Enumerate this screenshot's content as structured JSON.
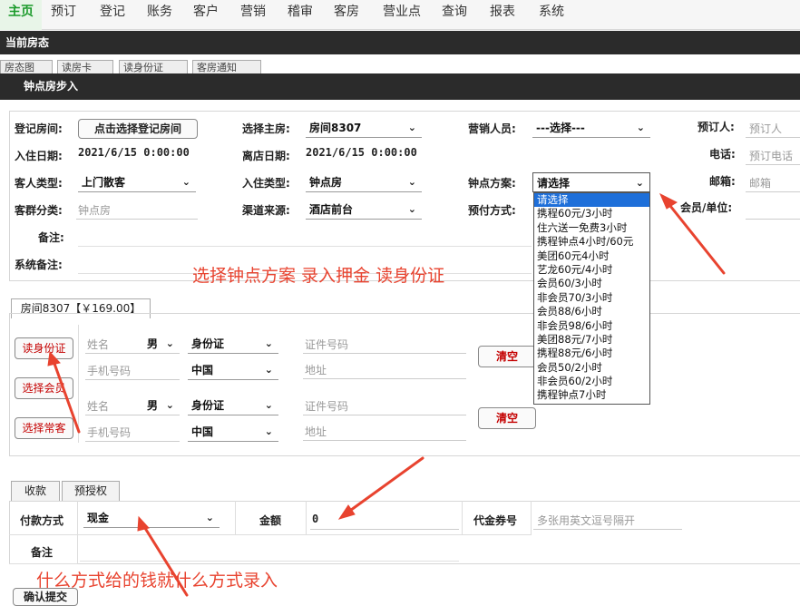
{
  "nav": [
    "主页",
    "预订",
    "登记",
    "账务",
    "客户",
    "营销",
    "稽审",
    "客房",
    "营业点",
    "查询",
    "报表",
    "系统"
  ],
  "current_status_bar": "当前房态",
  "bg_tabs": [
    "房态图",
    "读房卡",
    "读身份证",
    "客房通知"
  ],
  "window_title": "钟点房步入",
  "form": {
    "reg_room_label": "登记房间:",
    "reg_room_button": "点击选择登记房间",
    "main_room_label": "选择主房:",
    "main_room_value": "房间8307",
    "sales_label": "营销人员:",
    "sales_value": "---选择---",
    "booker_label": "预订人:",
    "booker_placeholder": "预订人",
    "checkin_label": "入住日期:",
    "checkin_value": "2021/6/15 0:00:00",
    "checkout_label": "离店日期:",
    "checkout_value": "2021/6/15 0:00:00",
    "phone_label": "电话:",
    "phone_placeholder": "预订电话",
    "guest_type_label": "客人类型:",
    "guest_type_value": "上门散客",
    "stay_type_label": "入住类型:",
    "stay_type_value": "钟点房",
    "plan_label": "钟点方案:",
    "plan_value": "请选择",
    "email_label": "邮箱:",
    "email_placeholder": "邮箱",
    "group_label": "客群分类:",
    "group_placeholder": "钟点房",
    "source_label": "渠道来源:",
    "source_value": "酒店前台",
    "prepay_label": "预付方式:",
    "member_label": "会员/单位:",
    "remark_label": "备注:",
    "sys_remark_label": "系统备注:"
  },
  "plan_options": [
    "请选择",
    "携程60元/3小时",
    "住六送一免费3小时",
    "携程钟点4小时/60元",
    "美团60元4小时",
    "艺龙60元/4小时",
    "会员60/3小时",
    "非会员70/3小时",
    "会员88/6小时",
    "非会员98/6小时",
    "美团88元/7小时",
    "携程88元/6小时",
    "会员50/2小时",
    "非会员60/2小时",
    "携程钟点7小时"
  ],
  "annotation1": "选择钟点方案  录入押金 读身份证",
  "room_tab": "房间8307【￥169.00】",
  "guest_buttons": {
    "read_id": "读身份证",
    "select_member": "选择会员",
    "select_regular": "选择常客"
  },
  "guests": [
    {
      "name_placeholder": "姓名",
      "gender": "男",
      "id_type": "身份证",
      "id_placeholder": "证件号码",
      "phone_placeholder": "手机号码",
      "country": "中国",
      "address_placeholder": "地址",
      "clear": "清空"
    },
    {
      "name_placeholder": "姓名",
      "gender": "男",
      "id_type": "身份证",
      "id_placeholder": "证件号码",
      "phone_placeholder": "手机号码",
      "country": "中国",
      "address_placeholder": "地址",
      "clear": "清空"
    }
  ],
  "pay_tabs": [
    "收款",
    "预授权"
  ],
  "payment": {
    "method_label": "付款方式",
    "method_value": "现金",
    "amount_label": "金额",
    "amount_value": "0",
    "voucher_label": "代金券号",
    "voucher_placeholder": "多张用英文逗号隔开",
    "remark_label": "备注"
  },
  "annotation2": "什么方式给的钱就什么方式录入",
  "submit_button": "确认提交",
  "colors": {
    "accent_green": "#1a9a2a",
    "annotation_red": "#e8432f",
    "dark_bar": "#2b2b2b",
    "select_blue": "#1e6fd9"
  }
}
